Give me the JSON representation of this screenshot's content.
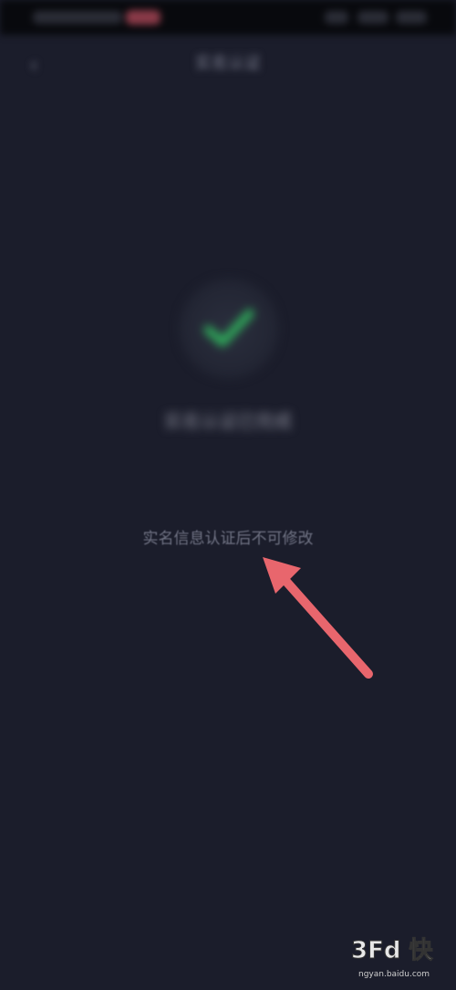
{
  "nav": {
    "back_icon": "chevron-left-icon",
    "title": "实名认证"
  },
  "status": {
    "icon": "check-icon",
    "check_color": "#2fae5b",
    "title": "实名认证已完成",
    "detail": "",
    "sub": ""
  },
  "notice": {
    "text": "实名信息认证后不可修改"
  },
  "annotation": {
    "arrow_color": "#e8666d"
  },
  "watermark": {
    "logo": "3Fd 快",
    "url": "ngyan.baidu.com"
  }
}
